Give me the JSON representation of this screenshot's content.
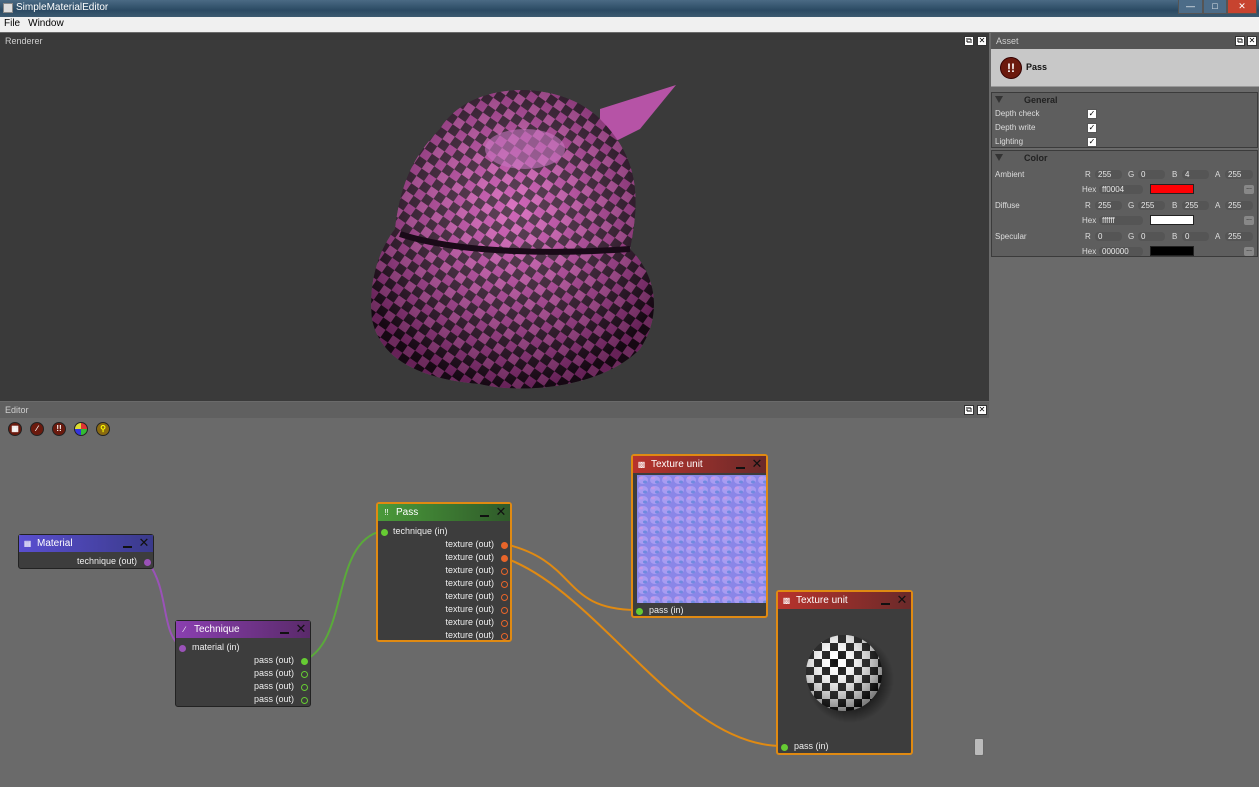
{
  "window": {
    "title": "SimpleMaterialEditor"
  },
  "menu": [
    "File",
    "Window"
  ],
  "panels": {
    "renderer": "Renderer",
    "editor": "Editor",
    "asset": "Asset"
  },
  "asset": {
    "name": "Pass",
    "icon": "pass-icon",
    "general": {
      "title": "General",
      "props": [
        {
          "label": "Depth check",
          "checked": true
        },
        {
          "label": "Depth write",
          "checked": true
        },
        {
          "label": "Lighting",
          "checked": true
        }
      ]
    },
    "color": {
      "title": "Color",
      "labels": {
        "r": "R",
        "g": "G",
        "b": "B",
        "a": "A",
        "hex": "Hex",
        "more": "..."
      },
      "ambient": {
        "label": "Ambient",
        "r": "255",
        "g": "0",
        "b": "4",
        "a": "255",
        "hex": "ff0004",
        "swatch": "#ff0004"
      },
      "diffuse": {
        "label": "Diffuse",
        "r": "255",
        "g": "255",
        "b": "255",
        "a": "255",
        "hex": "ffffff",
        "swatch": "#ffffff"
      },
      "specular": {
        "label": "Specular",
        "r": "0",
        "g": "0",
        "b": "0",
        "a": "255",
        "hex": "000000",
        "swatch": "#000000"
      }
    }
  },
  "toolbar_icons": [
    "material-icon",
    "technique-icon",
    "pass-icon",
    "texture-unit-icon",
    "search-icon"
  ],
  "nodes": {
    "material": {
      "title": "Material",
      "ports": [
        "technique (out)"
      ]
    },
    "technique": {
      "title": "Technique",
      "inputs": [
        "material (in)"
      ],
      "ports": [
        "pass (out)",
        "pass (out)",
        "pass (out)",
        "pass (out)"
      ]
    },
    "pass": {
      "title": "Pass",
      "inputs": [
        "technique (in)"
      ],
      "ports": [
        "texture (out)",
        "texture (out)",
        "texture (out)",
        "texture (out)",
        "texture (out)",
        "texture (out)",
        "texture (out)",
        "texture (out)"
      ]
    },
    "texture1": {
      "title": "Texture unit",
      "input": "pass (in)"
    },
    "texture2": {
      "title": "Texture unit",
      "input": "pass (in)"
    }
  },
  "colors": {
    "selection": "#e08a12",
    "material": "#5a4fd0",
    "technique": "#8a3fb0",
    "pass": "#4a9a3a",
    "texture": "#b8332c"
  }
}
